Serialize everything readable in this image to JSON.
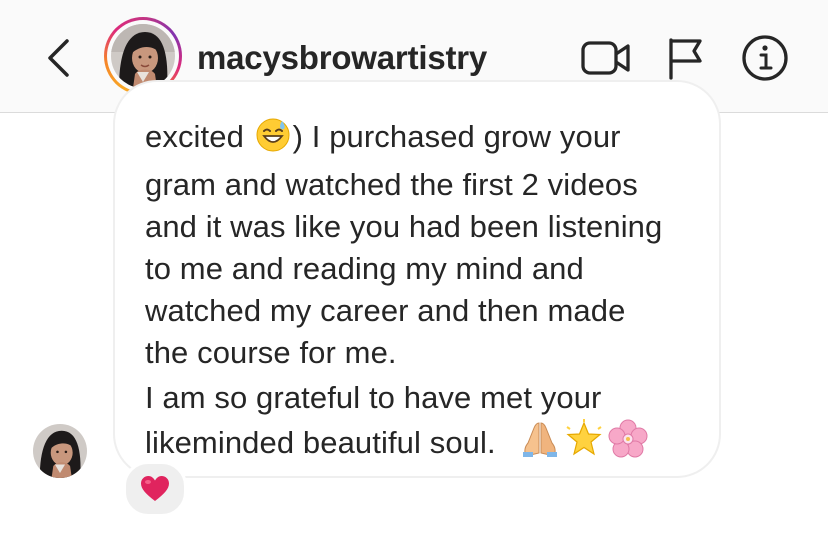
{
  "header": {
    "username": "macysbrowartistry",
    "back_icon": "chevron-left-icon",
    "video_icon": "video-camera-icon",
    "flag_icon": "flag-icon",
    "info_icon": "info-icon"
  },
  "message": {
    "lines": [
      {
        "before": "excited ",
        "emoji": "sweat-smile-emoji",
        "after": ") I purchased grow your"
      },
      {
        "text": "gram and watched the first 2 videos"
      },
      {
        "text": "and it was like you had been listening"
      },
      {
        "text": "to me and reading my mind and"
      },
      {
        "text": "watched my career and then  made"
      },
      {
        "text": "the course for me."
      },
      {
        "text": "I am so grateful to have met your"
      },
      {
        "text": "likeminded beautiful soul."
      }
    ],
    "trailing_emojis": [
      "folded-hands-emoji",
      "glowing-star-emoji",
      "cherry-blossom-emoji"
    ],
    "reaction": "red-heart-emoji"
  },
  "colors": {
    "header_bg": "#fafafa",
    "text": "#262626",
    "bubble_border": "#efefef",
    "heart": "#e0245e"
  }
}
